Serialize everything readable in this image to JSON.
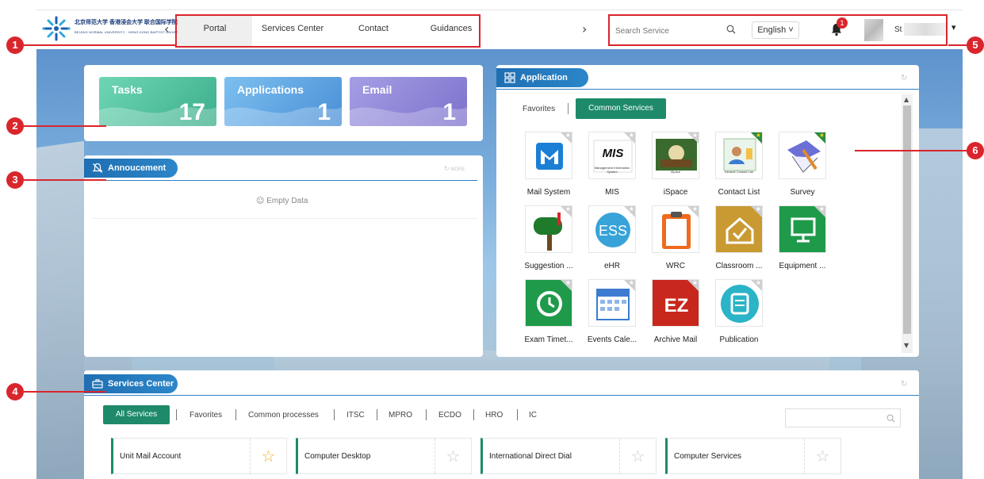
{
  "header": {
    "logo_cn": "北京师范大学 香港浸会大学 联合国际学院",
    "logo_en": "BEIJING NORMAL UNIVERSITY · HONG KONG BAPTIST UNIVERSITY · UNITED INTERNATIONAL COLLEGE",
    "nav_prev": "‹",
    "nav_next": "›",
    "tabs": [
      "Portal",
      "Services Center",
      "Contact",
      "Guidances"
    ],
    "search_placeholder": "Search Service",
    "language": "English ˅",
    "notification_count": "1",
    "user_name": "St",
    "user_menu": "▾"
  },
  "summary": {
    "tiles": [
      {
        "label": "Tasks",
        "count": "17"
      },
      {
        "label": "Applications",
        "count": "1"
      },
      {
        "label": "Email",
        "count": "1"
      }
    ]
  },
  "announcement": {
    "title": "Annoucement",
    "more": "MORE",
    "empty": "Empty Data"
  },
  "application": {
    "title": "Application",
    "tabs": [
      "Favorites",
      "Common Services"
    ],
    "apps": [
      {
        "name": "Mail System",
        "icon": "mail-system-icon",
        "fav": false
      },
      {
        "name": "MIS",
        "icon": "mis-icon",
        "fav": false,
        "caption": "Management Information System"
      },
      {
        "name": "iSpace",
        "icon": "ispace-icon",
        "fav": false,
        "caption": "iSpace"
      },
      {
        "name": "Contact List",
        "icon": "contact-list-icon",
        "fav": true,
        "caption": "Intranet Contact List"
      },
      {
        "name": "Survey",
        "icon": "survey-icon",
        "fav": true
      },
      {
        "name": "Suggestion ...",
        "icon": "suggestion-icon",
        "fav": false
      },
      {
        "name": "eHR",
        "icon": "ehr-icon",
        "fav": false
      },
      {
        "name": "WRC",
        "icon": "wrc-icon",
        "fav": false
      },
      {
        "name": "Classroom ...",
        "icon": "classroom-icon",
        "fav": false
      },
      {
        "name": "Equipment ...",
        "icon": "equipment-icon",
        "fav": false
      },
      {
        "name": "Exam Timet...",
        "icon": "exam-timetable-icon",
        "fav": false
      },
      {
        "name": "Events Cale...",
        "icon": "events-calendar-icon",
        "fav": false
      },
      {
        "name": "Archive Mail",
        "icon": "archive-mail-icon",
        "fav": false
      },
      {
        "name": "Publication",
        "icon": "publication-icon",
        "fav": false
      }
    ]
  },
  "services": {
    "title": "Services Center",
    "tabs": [
      "All Services",
      "Favorites",
      "Common processes",
      "ITSC",
      "MPRO",
      "ECDO",
      "HRO",
      "IC"
    ],
    "cards": [
      {
        "name": "Unit Mail Account",
        "fav": true
      },
      {
        "name": "Computer Desktop",
        "fav": false
      },
      {
        "name": "International Direct Dial",
        "fav": false
      },
      {
        "name": "Computer Services",
        "fav": false
      }
    ]
  },
  "callouts": [
    "1",
    "2",
    "3",
    "4",
    "5",
    "6"
  ],
  "colors": {
    "accent_blue": "#2c86c9",
    "accent_green": "#1e8a6a",
    "annotation_red": "#d9262c",
    "tasks_tile": "#4fc3a1",
    "applications_tile": "#5aa5e6",
    "email_tile": "#8f86d6"
  }
}
